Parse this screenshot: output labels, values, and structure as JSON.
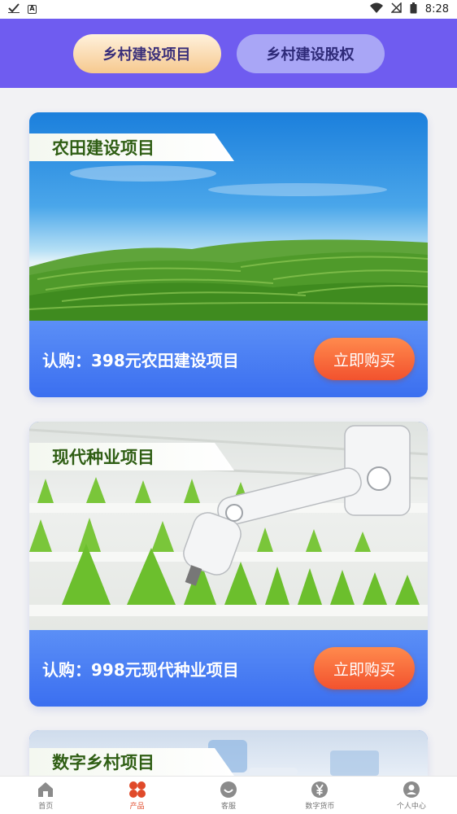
{
  "status_bar": {
    "time": "8:28",
    "icons": [
      "check-icon",
      "a-icon",
      "wifi-icon",
      "no-signal-icon",
      "battery-icon"
    ],
    "a_badge": "A"
  },
  "header": {
    "tabs": [
      {
        "label": "乡村建设项目",
        "active": true
      },
      {
        "label": "乡村建设股权",
        "active": false
      }
    ]
  },
  "cards": [
    {
      "title": "农田建设项目",
      "subscribe_text": "认购：398元农田建设项目",
      "buy_label": "立即购买",
      "image": "tea-field-landscape"
    },
    {
      "title": "现代种业项目",
      "subscribe_text": "认购：998元现代种业项目",
      "buy_label": "立即购买",
      "image": "greenhouse-robot-arm"
    },
    {
      "title": "数字乡村项目",
      "image": "digital-village"
    }
  ],
  "bottom_nav": {
    "items": [
      {
        "label": "首页",
        "icon": "home-icon",
        "active": false
      },
      {
        "label": "产品",
        "icon": "products-icon",
        "active": true
      },
      {
        "label": "客服",
        "icon": "customer-service-icon",
        "active": false
      },
      {
        "label": "数字货币",
        "icon": "yuan-icon",
        "active": false
      },
      {
        "label": "个人中心",
        "icon": "user-icon",
        "active": false
      }
    ]
  },
  "colors": {
    "header_bg": "#6f5cf0",
    "card_bottom": "#3f74ee",
    "buy_button": "#f2522e",
    "nav_active": "#e04a2a"
  }
}
